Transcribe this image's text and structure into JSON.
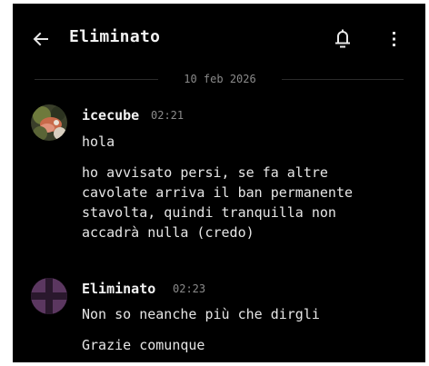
{
  "header": {
    "title": "Eliminato",
    "back_icon": "arrow-left-icon",
    "bell_icon": "bell-icon",
    "more_icon": "more-vertical-icon"
  },
  "date_separator": "10 feb 2026",
  "messages": [
    {
      "author": "icecube",
      "time": "02:21",
      "avatar_icon": "user-avatar",
      "lines": [
        "hola",
        "ho avvisato persi, se fa altre\ncavolate arriva il ban permanente\nstavolta, quindi tranquilla non\naccadrà nulla (credo)"
      ]
    },
    {
      "author": "Eliminato",
      "time": "02:23",
      "avatar_icon": "deleted-user-avatar",
      "lines": [
        "Non so neanche più che dirgli",
        "Grazie comunque"
      ]
    }
  ],
  "colors": {
    "background": "#000000",
    "text": "#e6e6e6",
    "muted": "#8a8a8a",
    "avatar_purple": "#5b3760"
  }
}
